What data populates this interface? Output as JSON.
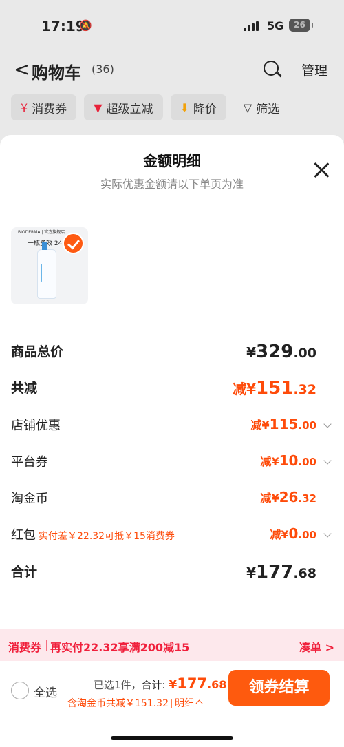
{
  "status_bar": {
    "time": "17:19",
    "network": "5G",
    "battery": "26"
  },
  "nav": {
    "back": "<",
    "title": "购物车",
    "count": "(36)",
    "manage": "管理"
  },
  "filters": [
    {
      "icon": "¥",
      "label": "消费券"
    },
    {
      "icon": "▼",
      "label": "超级立减"
    },
    {
      "icon": "⬇",
      "label": "降价"
    },
    {
      "icon": "▽",
      "label": "筛选"
    }
  ],
  "sheet": {
    "title": "金额明细",
    "subtitle": "实际优惠金额请以下单页为准",
    "product": {
      "brand_text": "BIODERMA | 官方旗舰店",
      "headline": "一瓶多效 24H保",
      "selected": true
    },
    "rows": {
      "subtotal": {
        "label": "商品总价",
        "yen": "¥",
        "int": "329",
        "dec": ".00"
      },
      "total_discount": {
        "label": "共减",
        "prefix": "减",
        "yen": "¥",
        "int": "151",
        "dec": ".32"
      },
      "shop_discount": {
        "label": "店铺优惠",
        "prefix": "减",
        "yen": "¥",
        "int": "115",
        "dec": ".00"
      },
      "platform_coupon": {
        "label": "平台券",
        "prefix": "减",
        "yen": "¥",
        "int": "10",
        "dec": ".00"
      },
      "taobao_coins": {
        "label": "淘金币",
        "prefix": "减",
        "yen": "¥",
        "int": "26",
        "dec": ".32"
      },
      "red_packet": {
        "label": "红包",
        "note": "实付差￥22.32可抵￥15消费券",
        "prefix": "减",
        "yen": "¥",
        "int": "0",
        "dec": ".00"
      },
      "total": {
        "label": "合计",
        "yen": "¥",
        "int": "177",
        "dec": ".68"
      }
    }
  },
  "promo": {
    "tag": "消费券",
    "text": "再实付22.32享满200减15",
    "link": "凑单 >"
  },
  "footer": {
    "select_all": "全选",
    "selected_count": "已选1件，",
    "total_label": "合计: ",
    "total_yen": "¥",
    "total_int": "177",
    "total_dec": ".68",
    "discount_note": "含淘金币共减￥151.32",
    "detail": "明细",
    "checkout": "领券结算"
  },
  "colors": {
    "accent": "#fe5a0e",
    "discount": "#fe4b0a",
    "promo": "#f0203c"
  }
}
